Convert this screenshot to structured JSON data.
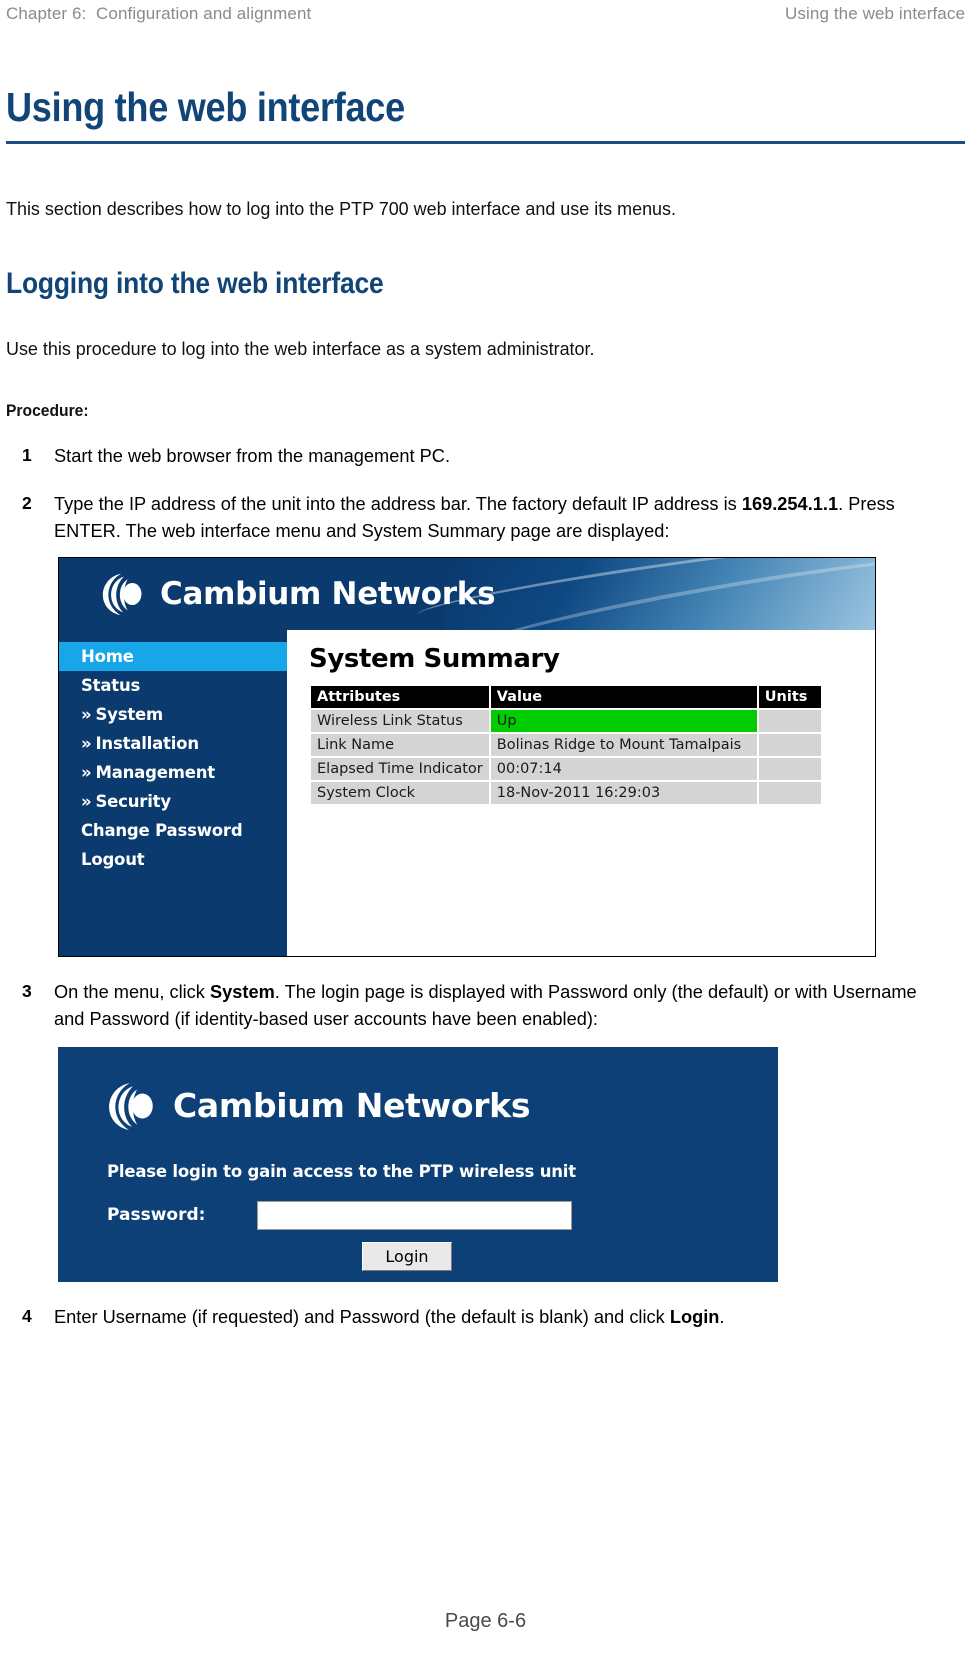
{
  "running_header": {
    "left": "Chapter 6:  Configuration and alignment",
    "right": "Using the web interface"
  },
  "title": "Using the web interface",
  "intro": "This section describes how to log into the PTP 700 web interface and use its menus.",
  "section": {
    "heading": "Logging into the web interface",
    "intro": "Use this procedure to log into the web interface as a system administrator.",
    "procedure_label": "Procedure:"
  },
  "steps": [
    {
      "num": "1",
      "text": "Start the web browser from the management PC."
    },
    {
      "num": "2",
      "text_before": "Type the IP address of the unit into the address bar. The factory default IP address is ",
      "bold": "169.254.1.1",
      "text_after": ". Press ENTER. The web interface menu and System Summary page are displayed:"
    },
    {
      "num": "3",
      "text_before": "On the menu, click ",
      "bold": "System",
      "text_after": ". The login page is displayed with Password only (the default) or with Username and Password (if identity-based user accounts have been enabled):"
    },
    {
      "num": "4",
      "text_before": "Enter Username (if requested) and Password (the default is blank) and click ",
      "bold": "Login",
      "text_after": "."
    }
  ],
  "summary_screenshot": {
    "brand_name": "Cambium Networks",
    "nav": [
      {
        "label": "Home",
        "chevron": "",
        "active": true
      },
      {
        "label": "Status",
        "chevron": "",
        "active": false
      },
      {
        "label": "System",
        "chevron": "»",
        "active": false
      },
      {
        "label": "Installation",
        "chevron": "»",
        "active": false
      },
      {
        "label": "Management",
        "chevron": "»",
        "active": false
      },
      {
        "label": "Security",
        "chevron": "»",
        "active": false
      },
      {
        "label": "Change Password",
        "chevron": "",
        "active": false
      },
      {
        "label": "Logout",
        "chevron": "",
        "active": false
      }
    ],
    "page_title": "System Summary",
    "table": {
      "headers": [
        "Attributes",
        "Value",
        "Units"
      ],
      "rows": [
        {
          "attribute": "Wireless Link Status",
          "value": "Up",
          "units": "",
          "value_highlight": "#00cc00"
        },
        {
          "attribute": "Link Name",
          "value": "Bolinas Ridge to Mount Tamalpais",
          "units": ""
        },
        {
          "attribute": "Elapsed Time Indicator",
          "value": "00:07:14",
          "units": ""
        },
        {
          "attribute": "System Clock",
          "value": "18-Nov-2011 16:29:03",
          "units": ""
        }
      ]
    }
  },
  "login_screenshot": {
    "brand_name": "Cambium Networks",
    "message": "Please login to gain access to the PTP wireless unit",
    "password_label": "Password:",
    "password_value": "",
    "login_button": "Login"
  },
  "footer": "Page 6-6",
  "colors": {
    "heading_blue": "#114477",
    "rule_blue": "#1b4f84",
    "panel_blue": "#0a3a6e",
    "login_blue": "#0c4077",
    "active_nav": "#17a7e8",
    "status_green": "#00cc00",
    "table_cell": "#d4d4d4"
  }
}
